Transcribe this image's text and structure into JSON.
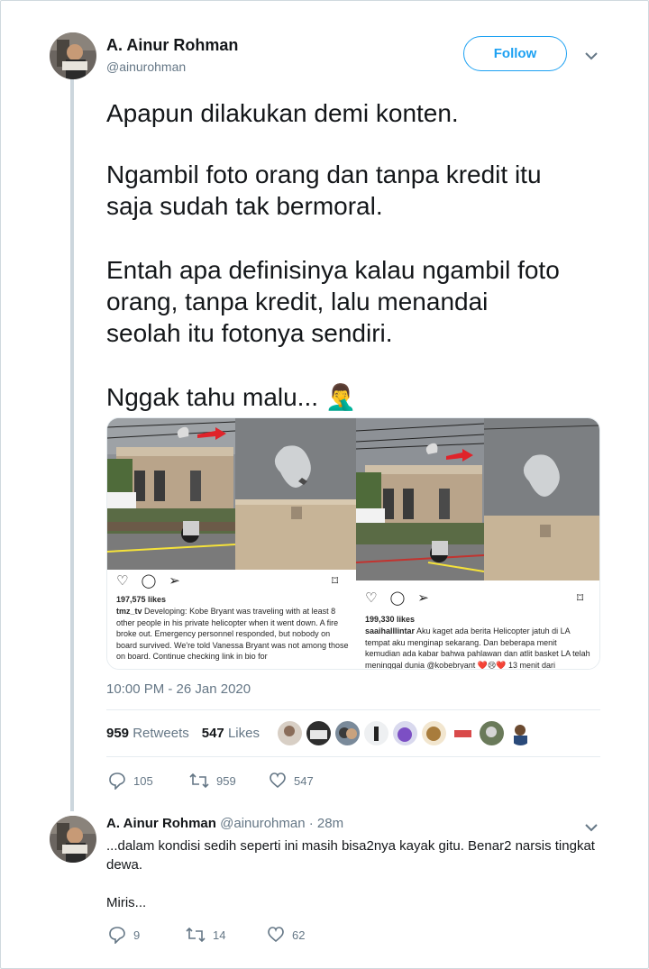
{
  "tweet": {
    "author_name": "A. Ainur Rohman",
    "author_handle": "@ainurohman",
    "follow_label": "Follow",
    "text_lines": [
      "Apapun dilakukan demi konten.",
      "Ngambil foto orang dan tanpa kredit itu",
      "saja sudah tak bermoral.",
      "Entah apa definisinya kalau ngambil foto",
      "orang, tanpa kredit, lalu menandai",
      "seolah itu fotonya sendiri.",
      "Nggak tahu malu... 🤦‍♂️"
    ],
    "timestamp": "10:00 PM - 26 Jan 2020",
    "retweets_count": "959",
    "retweets_label": "Retweets",
    "likes_count": "547",
    "likes_label": "Likes",
    "actions": {
      "reply_count": "105",
      "retweet_count": "959",
      "like_count": "547"
    }
  },
  "media": {
    "left_post": {
      "likes": "197,575 likes",
      "username": "tmz_tv",
      "caption": "Developing: Kobe Bryant was traveling with at least 8 other people in his private helicopter when it went down. A fire broke out. Emergency personnel responded, but nobody on board survived. We're told Vanessa Bryant was not among those on board. Continue checking link in bio for"
    },
    "right_post": {
      "likes": "199,330 likes",
      "username": "saaihalllintar",
      "caption": "Aku kaget ada berita Helicopter jatuh di LA tempat aku menginap sekarang. Dan beberapa menit kemudian ada kabar bahwa pahlawan dan atlit basket LA telah meninggal dunia @kobebryant ❤️😢❤️ 13 menit dari"
    }
  },
  "reply": {
    "author_name": "A. Ainur Rohman",
    "author_handle": "@ainurohman",
    "time": "· 28m",
    "text_line1": "...dalam kondisi sedih seperti ini masih bisa2nya kayak gitu. Benar2 narsis tingkat",
    "text_line2": "dewa.",
    "text_line3": "Miris...",
    "actions": {
      "reply_count": "9",
      "retweet_count": "14",
      "like_count": "62"
    }
  },
  "icons": [
    "chevron-down-icon",
    "reply-icon",
    "retweet-icon",
    "heart-icon",
    "bookmark-icon",
    "comment-icon",
    "share-icon"
  ],
  "colors": {
    "accent": "#1da1f2",
    "muted": "#657786",
    "thread": "#ccd6dd",
    "arrow": "#e0232a"
  }
}
